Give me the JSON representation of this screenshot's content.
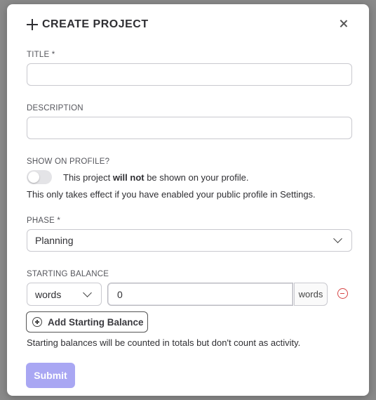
{
  "modal": {
    "title": "CREATE PROJECT"
  },
  "form": {
    "title_label": "TITLE *",
    "title_value": "",
    "description_label": "DESCRIPTION",
    "description_value": "",
    "show_on_profile_label": "SHOW ON PROFILE?",
    "toggle_text_before": "This project ",
    "toggle_text_bold": "will not",
    "toggle_text_after": " be shown on your profile.",
    "toggle_on": false,
    "profile_helper": "This only takes effect if you have enabled your public profile in Settings.",
    "phase_label": "PHASE *",
    "phase_value": "Planning",
    "starting_balance_label": "STARTING BALANCE",
    "unit_value": "words",
    "amount_value": "0",
    "amount_suffix": "words",
    "add_balance_label": "Add Starting Balance",
    "balance_helper": "Starting balances will be counted in totals but don't count as activity.",
    "submit_label": "Submit"
  },
  "colors": {
    "submit_bg": "#a9a7f3",
    "remove_icon": "#d64545",
    "toggle_off": "#e4e4e7"
  }
}
